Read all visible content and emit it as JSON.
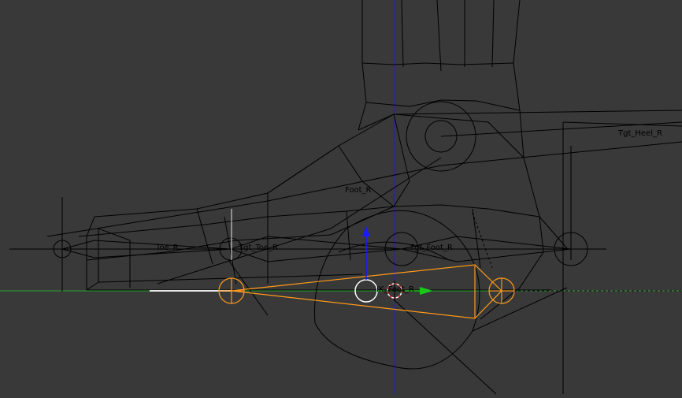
{
  "colors": {
    "background": "#393939",
    "wire": "#000000",
    "axis_x": "#2da32d",
    "axis_z": "#1f1fb5",
    "selected_bone": "#ff9a1a",
    "gizmo_z": "#1a1aff",
    "gizmo_y": "#19c919",
    "cursor_red": "#ff2a2a"
  },
  "viewport": {
    "mode": "3d-view",
    "labels": {
      "heel": "Tgt_Heel_R",
      "foot": "Foot_R",
      "toe": "Toe_R",
      "tgt_toe": "Tgt_Toe_R",
      "tgt_foot": "Tgt_Foot_R",
      "ik_foot": "IK_Foot_R"
    }
  }
}
